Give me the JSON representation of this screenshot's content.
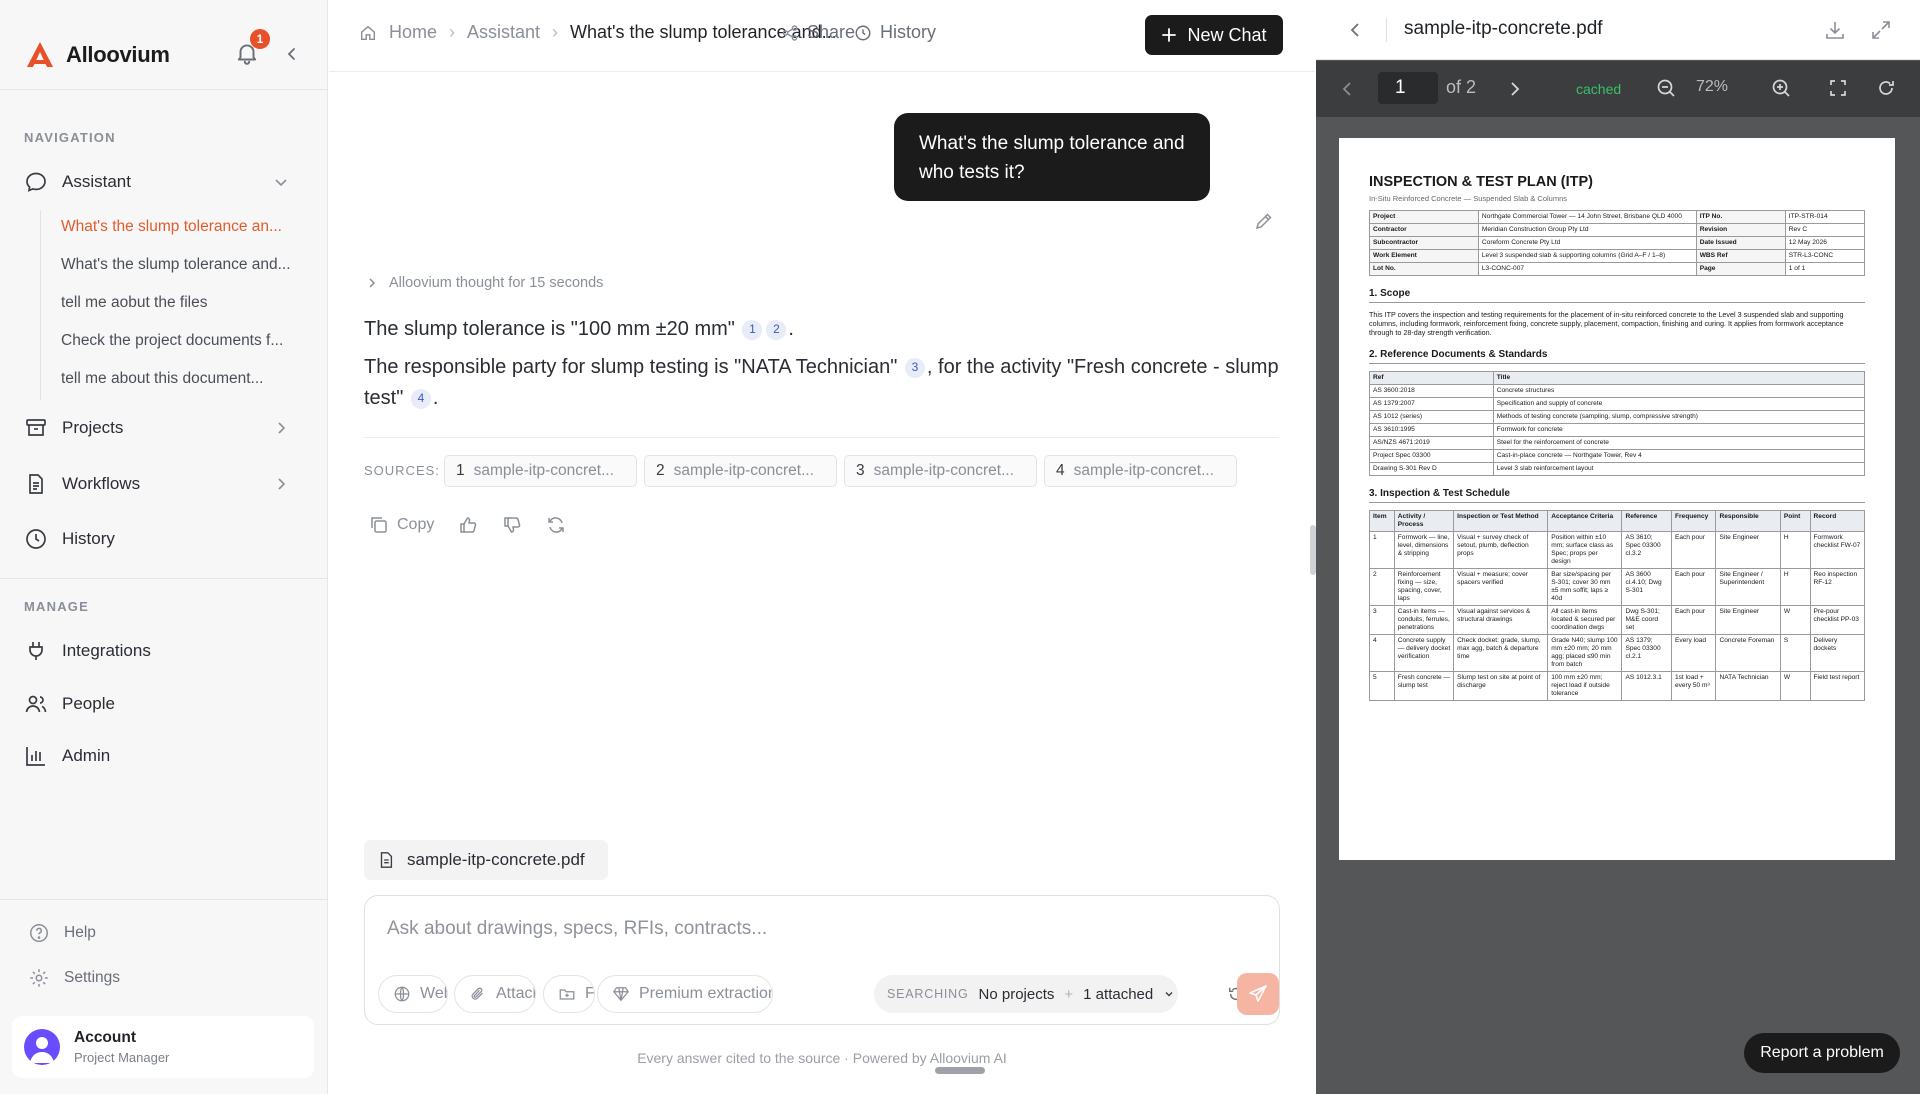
{
  "brand": {
    "name": "Alloovium",
    "accent": "#e8502a"
  },
  "notifications": {
    "count": "1"
  },
  "sidebar": {
    "navigation_label": "NAVIGATION",
    "assistant_label": "Assistant",
    "chats": [
      "What's the slump tolerance an...",
      "What's the slump tolerance and...",
      "tell me aobut the files",
      "Check the project documents f...",
      "tell me about this document..."
    ],
    "projects_label": "Projects",
    "workflows_label": "Workflows",
    "history_label": "History",
    "manage_label": "MANAGE",
    "integrations_label": "Integrations",
    "people_label": "People",
    "admin_label": "Admin",
    "help_label": "Help",
    "settings_label": "Settings",
    "account": {
      "name": "Account",
      "role": "Project Manager"
    }
  },
  "header": {
    "home": "Home",
    "assistant": "Assistant",
    "current": "What's the slump tolerance and...",
    "share": "Share",
    "history": "History",
    "new_chat": "New Chat"
  },
  "chat": {
    "user_message": "What's the slump tolerance and who tests it?",
    "thought": "Alloovium thought for 15 seconds",
    "answer1": {
      "pre": "The slump tolerance is \"100 mm ±20 mm\"",
      "cites": [
        "1",
        "2"
      ],
      "post": "."
    },
    "answer2": {
      "pre": "The responsible party for slump testing is \"NATA Technician\"",
      "cite_a": "3",
      "mid": ", for the activity \"Fresh concrete - slump test\"",
      "cite_b": "4",
      "post": "."
    },
    "sources_label": "SOURCES:",
    "sources": [
      {
        "num": "1",
        "name": "sample-itp-concret..."
      },
      {
        "num": "2",
        "name": "sample-itp-concret..."
      },
      {
        "num": "3",
        "name": "sample-itp-concret..."
      },
      {
        "num": "4",
        "name": "sample-itp-concret..."
      }
    ],
    "copy_label": "Copy"
  },
  "composer": {
    "attached_file": "sample-itp-concrete.pdf",
    "placeholder": "Ask about drawings, specs, RFIs, contracts...",
    "web": "Web",
    "attach": "Attach",
    "folder": "Fol",
    "premium": "Premium extraction",
    "searching_label": "SEARCHING",
    "scope": "No projects",
    "attached": "1 attached",
    "footer": "Every answer cited to the source · Powered by Alloovium AI"
  },
  "pdf": {
    "filename": "sample-itp-concrete.pdf",
    "page": "1",
    "of_pages": "of 2",
    "cache_status": "cached",
    "zoom": "72%",
    "doc": {
      "title": "INSPECTION & TEST PLAN (ITP)",
      "subtitle": "In-Situ Reinforced Concrete — Suspended Slab & Columns",
      "meta": [
        [
          "Project",
          "Northgate Commercial Tower — 14 John Street, Brisbane QLD 4000",
          "ITP No.",
          "ITP-STR-014"
        ],
        [
          "Contractor",
          "Meridian Construction Group Pty Ltd",
          "Revision",
          "Rev C"
        ],
        [
          "Subcontractor",
          "Coreform Concrete Pty Ltd",
          "Date Issued",
          "12 May 2026"
        ],
        [
          "Work Element",
          "Level 3 suspended slab & supporting columns (Grid A–F / 1–8)",
          "WBS Ref",
          "STR-L3-CONC"
        ],
        [
          "Lot No.",
          "L3-CONC-007",
          "Page",
          "1 of 1"
        ]
      ],
      "scope_heading": "1. Scope",
      "scope_text": "This ITP covers the inspection and testing requirements for the placement of in-situ reinforced concrete to the Level 3 suspended slab and supporting columns, including formwork, reinforcement fixing, concrete supply, placement, compaction, finishing and curing. It applies from formwork acceptance through to 28-day strength verification.",
      "refs_heading": "2. Reference Documents & Standards",
      "refs_header": [
        "Ref",
        "Title"
      ],
      "refs": [
        [
          "AS 3600:2018",
          "Concrete structures"
        ],
        [
          "AS 1379:2007",
          "Specification and supply of concrete"
        ],
        [
          "AS 1012 (series)",
          "Methods of testing concrete (sampling, slump, compressive strength)"
        ],
        [
          "AS 3610:1995",
          "Formwork for concrete"
        ],
        [
          "AS/NZS 4671:2019",
          "Steel for the reinforcement of concrete"
        ],
        [
          "Project Spec 03300",
          "Cast-in-place concrete — Northgate Tower, Rev 4"
        ],
        [
          "Drawing S-301 Rev D",
          "Level 3 slab reinforcement layout"
        ]
      ],
      "schedule_heading": "3. Inspection & Test Schedule",
      "schedule_header": [
        "Item",
        "Activity / Process",
        "Inspection or Test Method",
        "Acceptance Criteria",
        "Reference",
        "Frequency",
        "Responsible",
        "Point",
        "Record"
      ],
      "schedule": [
        [
          "1",
          "Formwork — line, level, dimensions & stripping",
          "Visual + survey check of setout, plumb, deflection props",
          "Position within ±10 mm; surface class as Spec; props per design",
          "AS 3610; Spec 03300 cl.3.2",
          "Each pour",
          "Site Engineer",
          "H",
          "Formwork checklist FW-07"
        ],
        [
          "2",
          "Reinforcement fixing — size, spacing, cover, laps",
          "Visual + measure; cover spacers verified",
          "Bar size/spacing per S-301; cover 30 mm ±5 mm soffit; laps ≥ 40d",
          "AS 3600 cl.4.10; Dwg S-301",
          "Each pour",
          "Site Engineer / Superintendent",
          "H",
          "Reo inspection RF-12"
        ],
        [
          "3",
          "Cast-in items — conduits, ferrules, penetrations",
          "Visual against services & structural drawings",
          "All cast-in items located & secured per coordination dwgs",
          "Dwg S-301; M&E coord set",
          "Each pour",
          "Site Engineer",
          "W",
          "Pre-pour checklist PP-03"
        ],
        [
          "4",
          "Concrete supply — delivery docket verification",
          "Check docket: grade, slump, max agg, batch & departure time",
          "Grade N40; slump 100 mm ±20 mm; 20 mm agg; placed ≤90 min from batch",
          "AS 1379; Spec 03300 cl.2.1",
          "Every load",
          "Concrete Foreman",
          "S",
          "Delivery dockets"
        ],
        [
          "5",
          "Fresh concrete — slump test",
          "Slump test on site at point of discharge",
          "100 mm ±20 mm; reject load if outside tolerance",
          "AS 1012.3.1",
          "1st load + every 50 m³",
          "NATA Technician",
          "W",
          "Field test report"
        ]
      ]
    }
  },
  "report_problem": "Report a problem"
}
